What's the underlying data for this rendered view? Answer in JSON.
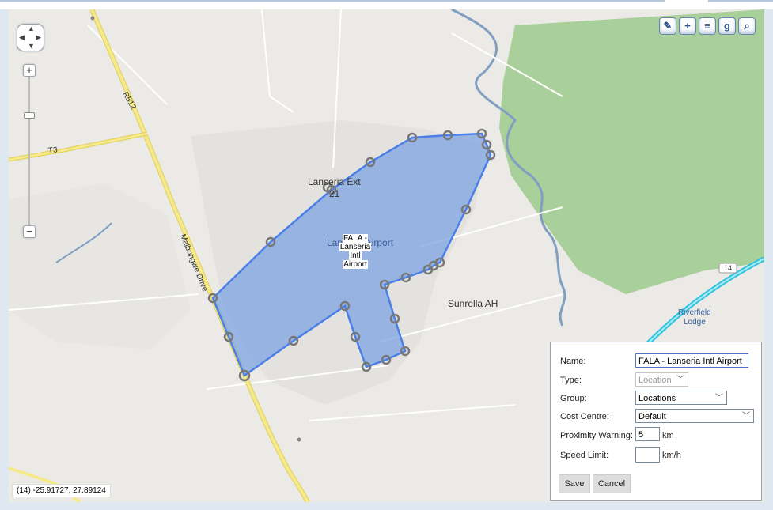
{
  "map": {
    "labels": {
      "road_r512": "R512",
      "road_t3": "T3",
      "road_malbongwe": "Malbongwe Drive",
      "lanseria_ext": "Lanseria Ext",
      "lanseria_ext_num": "21",
      "airport_bg": "Lanseria Airport",
      "sunrella": "Sunrella AH",
      "riverfield": "Riverfield",
      "riverfield2": "Lodge",
      "route_14": "14"
    },
    "polygon_label": {
      "line1": "FALA -",
      "line2": "Lanseria",
      "line3": "Intl",
      "line4": "Airport"
    },
    "coordinates": "(14) -25.91727, 27.89124",
    "colors": {
      "polygon_fill": "#7ea3e2",
      "polygon_stroke": "#4a7fe8",
      "park": "#a9cf9b",
      "water": "#7f9ec0",
      "road_major": "#f5e98a",
      "highway": "#33c3e0"
    }
  },
  "controls": {
    "pan_icon": "pan-arrows-icon",
    "zoom_in": "+",
    "zoom_out": "−",
    "toolbar": [
      "edit-icon",
      "add-icon",
      "layers-icon",
      "google-icon",
      "search-icon"
    ]
  },
  "form": {
    "name_label": "Name:",
    "name_value": "FALA -  Lanseria Intl Airport",
    "type_label": "Type:",
    "type_value": "Location",
    "group_label": "Group:",
    "group_value": "Locations",
    "cost_label": "Cost Centre:",
    "cost_value": "Default",
    "prox_label": "Proximity Warning:",
    "prox_value": "5",
    "prox_unit": "km",
    "speed_label": "Speed Limit:",
    "speed_value": "",
    "speed_unit": "km/h",
    "save": "Save",
    "cancel": "Cancel"
  }
}
